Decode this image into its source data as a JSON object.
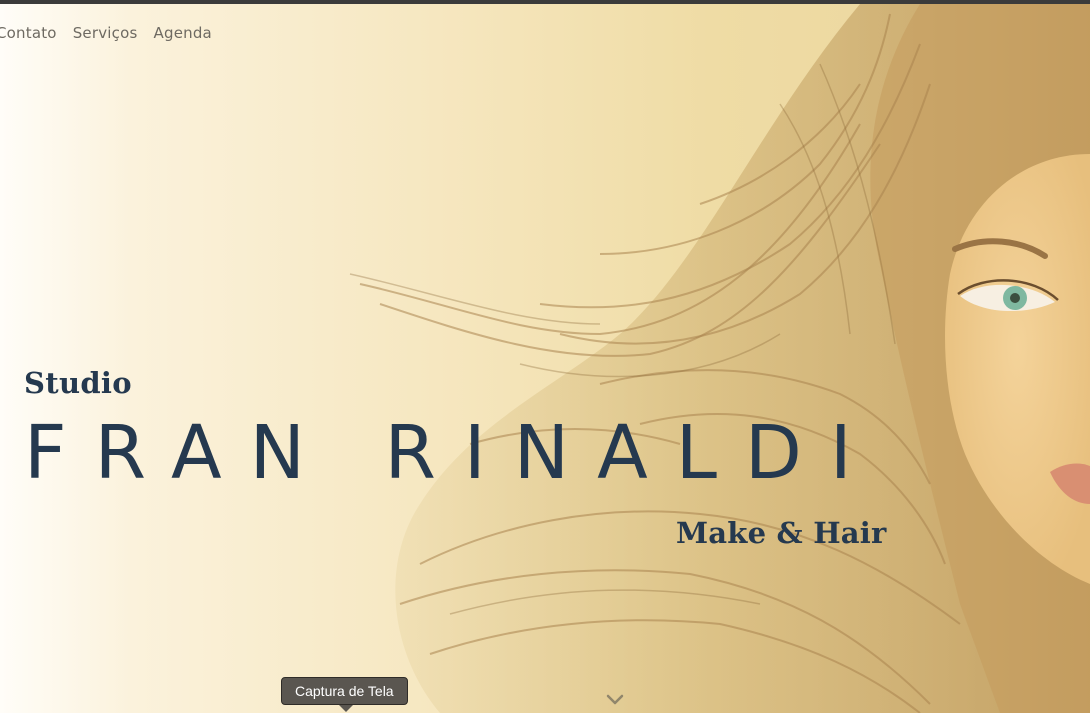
{
  "nav": {
    "items": [
      {
        "label": "Contato"
      },
      {
        "label": "Serviços"
      },
      {
        "label": "Agenda"
      }
    ]
  },
  "hero": {
    "pre_title": "Studio",
    "title": "FRAN RINALDI",
    "subtitle": "Make & Hair",
    "image": "woman-with-flowing-hair-photo"
  },
  "tooltip": {
    "text": "Captura de Tela"
  },
  "colors": {
    "title": "#25394f",
    "nav": "#6e6a62",
    "background_warm": "#efdca5"
  },
  "icons": {
    "scroll": "chevron-down-icon"
  }
}
